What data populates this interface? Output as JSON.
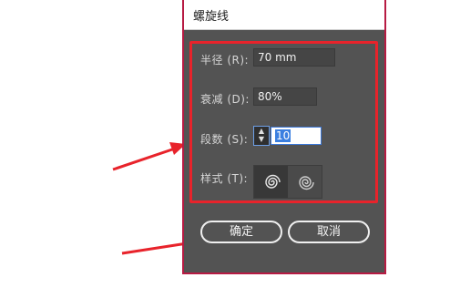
{
  "dialog": {
    "title": "螺旋线",
    "fields": {
      "radius_label": "半径 (R):",
      "radius_value": "70 mm",
      "decay_label": "衰减 (D):",
      "decay_value": "80%",
      "segments_label": "段数 (S):",
      "segments_value": "10",
      "style_label": "样式 (T):"
    },
    "style_options": [
      {
        "icon": "spiral-clockwise-icon",
        "selected": true
      },
      {
        "icon": "spiral-counterclockwise-icon",
        "selected": false
      }
    ],
    "ok_label": "确定",
    "cancel_label": "取消"
  },
  "colors": {
    "dialog_bg": "#535353",
    "highlight_box": "#e8232b",
    "annotation_arrow": "#e8232b"
  }
}
